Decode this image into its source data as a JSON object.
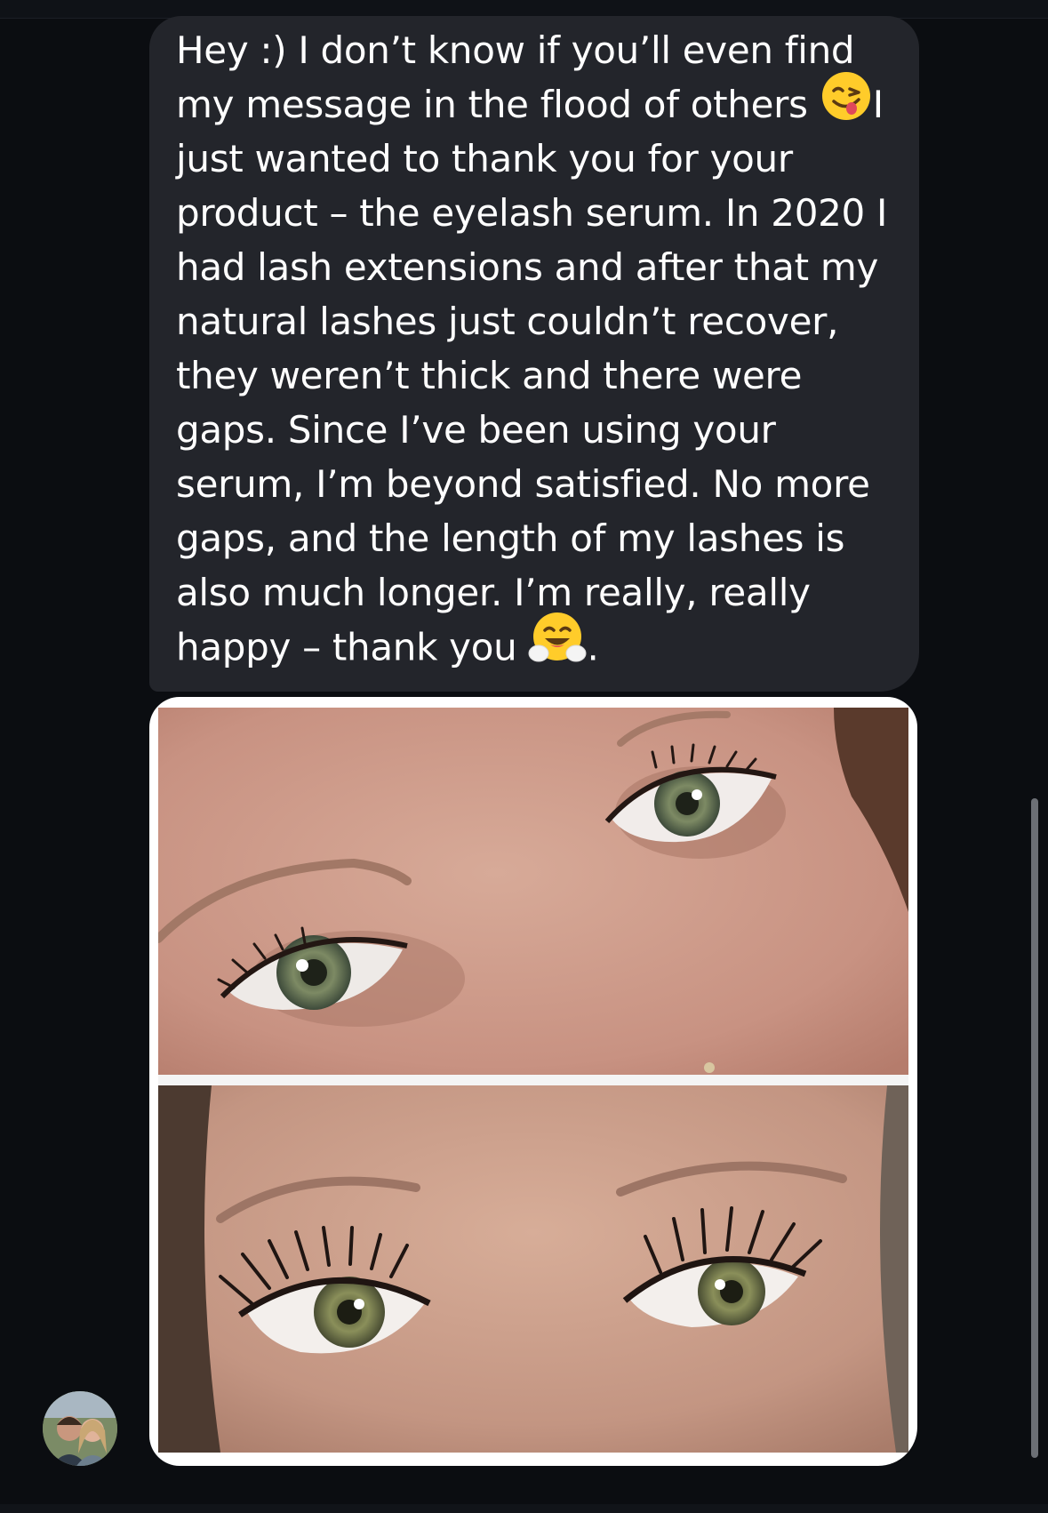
{
  "message": {
    "lines": [
      "Hey :) I don’t know if you’ll even find",
      "my message in the flood of others",
      "I",
      "just wanted to thank you for your",
      "product – the eyelash serum. In 2020 I",
      "had lash extensions and after that my",
      "natural lashes just couldn’t recover,",
      "they weren’t thick and there were",
      "gaps. Since I’ve been using your",
      "serum, I’m beyond satisfied. No more",
      "gaps, and the length of my lashes is",
      "also much longer. I’m really, really",
      "happy – thank you",
      "."
    ],
    "emojis": [
      "winking-face-tongue-icon",
      "hugging-face-icon"
    ]
  },
  "photos": [
    {
      "name": "before-eyes-photo"
    },
    {
      "name": "after-eyes-photo"
    }
  ],
  "colors": {
    "background": "#0b0d11",
    "bubble": "#23252b",
    "text": "#ffffff",
    "emoji_yellow": "#ffcc2a"
  }
}
